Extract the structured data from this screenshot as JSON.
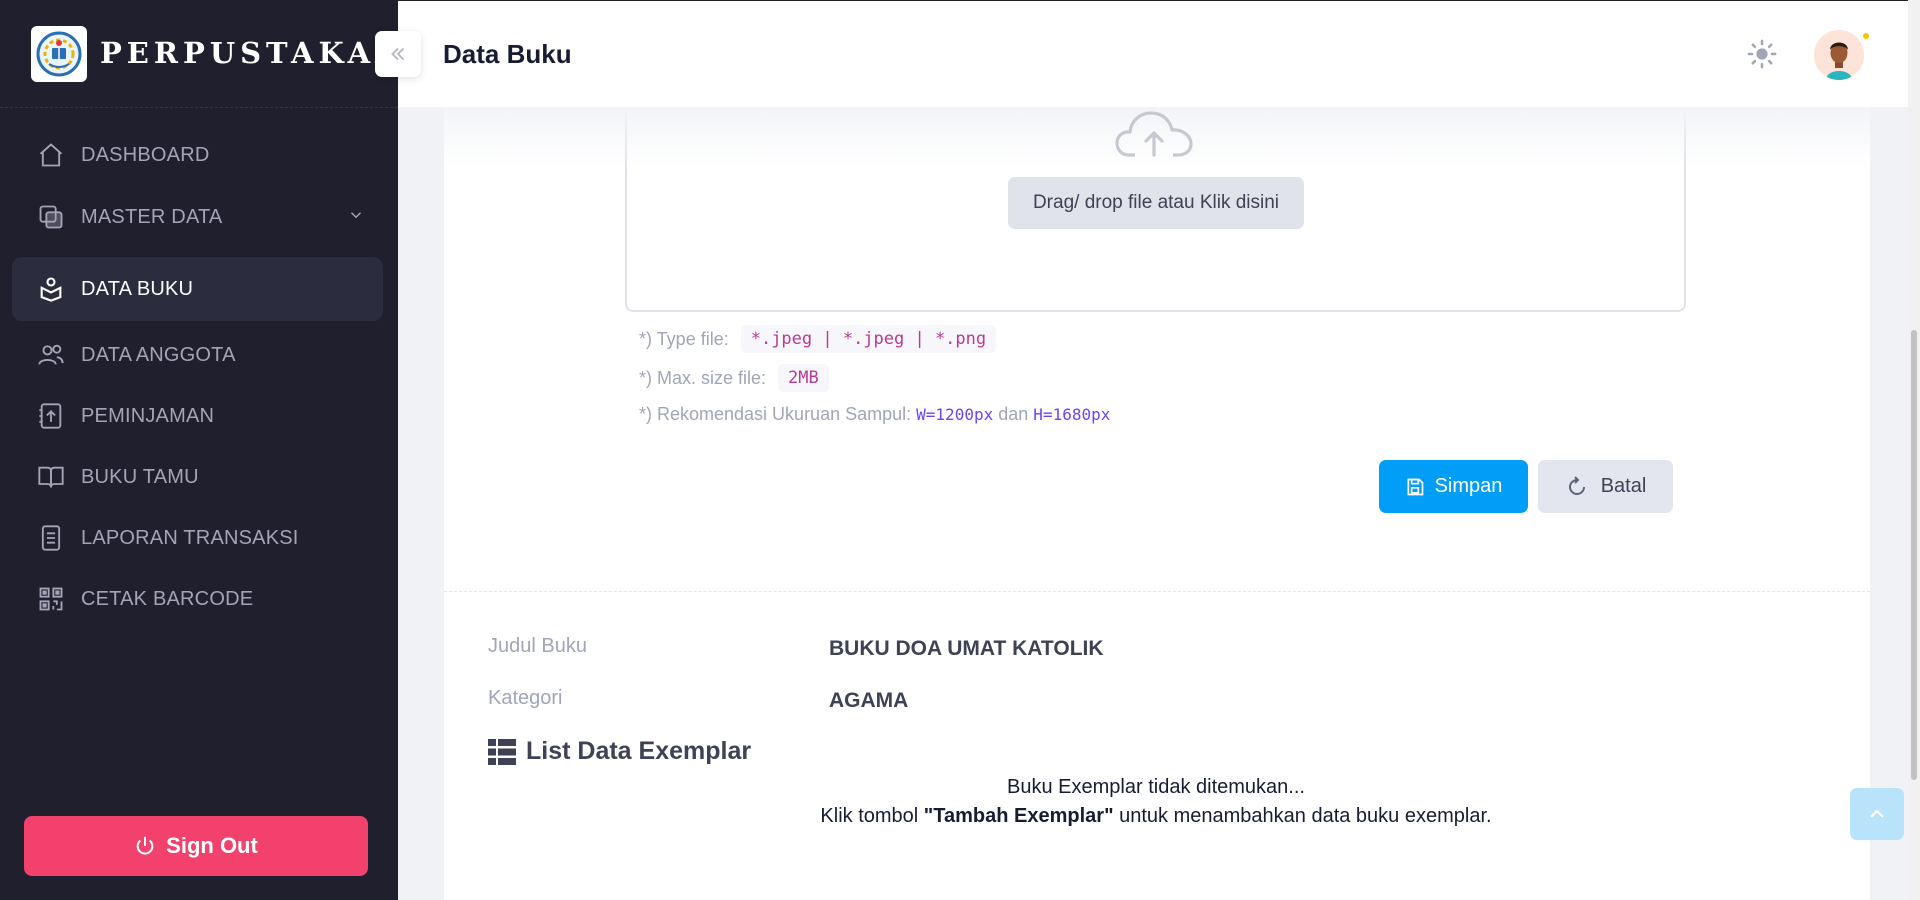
{
  "sidebar": {
    "brand": "PERPUSTAKAAN",
    "items": [
      {
        "label": "DASHBOARD",
        "icon": "home-icon"
      },
      {
        "label": "MASTER DATA",
        "icon": "layers-icon"
      },
      {
        "label": "DATA BUKU",
        "icon": "book-reader-icon"
      },
      {
        "label": "DATA ANGGOTA",
        "icon": "users-icon"
      },
      {
        "label": "PEMINJAMAN",
        "icon": "upload-doc-icon"
      },
      {
        "label": "BUKU TAMU",
        "icon": "open-book-icon"
      },
      {
        "label": "LAPORAN TRANSAKSI",
        "icon": "document-icon"
      },
      {
        "label": "CETAK BARCODE",
        "icon": "qr-code-icon"
      }
    ],
    "active_item": "DATA BUKU",
    "signout_label": "Sign Out"
  },
  "header": {
    "title": "Data Buku"
  },
  "upload": {
    "dropzone_label": "Drag/ drop file atau Klik disini",
    "type_label": "*) Type file:",
    "type_value": "*.jpeg | *.jpeg | *.png",
    "size_label": "*) Max. size file:",
    "size_value": "2MB",
    "recommend_label": "*) Rekomendasi Ukuruan Sampul:",
    "recommend_w": "W=1200px",
    "recommend_and": "dan",
    "recommend_h": "H=1680px"
  },
  "actions": {
    "save_label": "Simpan",
    "cancel_label": "Batal"
  },
  "detail": {
    "title_label": "Judul Buku",
    "title_value": "BUKU DOA UMAT KATOLIK",
    "category_label": "Kategori",
    "category_value": "AGAMA"
  },
  "exemplar": {
    "section_title": "List Data Exemplar",
    "empty_line1": "Buku Exemplar tidak ditemukan...",
    "empty_line2_pre": "Klik tombol ",
    "empty_line2_bold": "\"Tambah Exemplar\"",
    "empty_line2_post": " untuk menambahkan data buku exemplar."
  },
  "colors": {
    "sidebar_bg": "#1f1f2e",
    "primary": "#009ef7",
    "danger": "#f1416c"
  }
}
